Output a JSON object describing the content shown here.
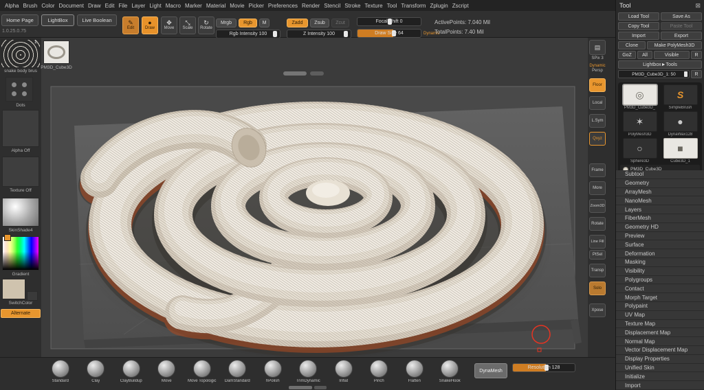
{
  "colors": {
    "accent": "#e8962e",
    "panel": "#2a2a2a",
    "canvas": "#3b3b3b",
    "model": "#e8e1d4",
    "underglow": "#a84a22",
    "cursor_red": "#e63422"
  },
  "icons": {
    "close": "⊠",
    "edit": "✎",
    "draw": "●",
    "move": "✥",
    "scale": "⤡",
    "rotate": "↻",
    "spix": "▤"
  },
  "menubar": {
    "items": [
      "Alpha",
      "Brush",
      "Color",
      "Document",
      "Draw",
      "Edit",
      "File",
      "Layer",
      "Light",
      "Macro",
      "Marker",
      "Material",
      "Movie",
      "Picker",
      "Preferences",
      "Render",
      "Stencil",
      "Stroke",
      "Texture",
      "Tool",
      "Transform",
      "Zplugin",
      "Zscript"
    ]
  },
  "topbar": {
    "version": "1.0.25.0.75",
    "home_page": "Home Page",
    "lightbox": "LightBox",
    "live_boolean": "Live Boolean",
    "edit": "Edit",
    "draw": "Draw",
    "move": "Move",
    "scale": "Scale",
    "rotate": "Rotate",
    "mrgb": "Mrgb",
    "rgb": "Rgb",
    "m": "M",
    "zadd": "Zadd",
    "zsub": "Zsub",
    "zcut": "Zcut",
    "rgb_intensity": {
      "label": "Rgb Intensity",
      "value": "100"
    },
    "z_intensity": {
      "label": "Z Intensity",
      "value": "100"
    },
    "focal_shift": {
      "label": "Focal Shift",
      "value": "0"
    },
    "draw_size": {
      "label": "Draw Size",
      "value": "64"
    },
    "dynamic": "Dynamic",
    "active_points": "ActivePoints: 7.040 Mil",
    "total_points": "TotalPoints: 7.40 Mil"
  },
  "left_shelf": {
    "brush_name": "snake body brus",
    "brush_badge": "1",
    "tool_name": "PM3D_Cube3D",
    "stroke_name": "Dots",
    "alpha": "Alpha Off",
    "texture": "Texture Off",
    "material": "SkinShade4",
    "gradient": "Gradient",
    "switch_color": "SwitchColor",
    "alternate": "Alternate"
  },
  "right_shelf": {
    "spix": "SPix 3",
    "persp_line1": "Dynamic",
    "persp_line2": "Persp",
    "floor": "Floor",
    "local": "Local",
    "lsym": "L.Sym",
    "qxyz": "Qxyz",
    "frame": "Frame",
    "more": "More",
    "zoom": "Zoom3D",
    "rotate": "Rotate",
    "linefill": "Line Fill",
    "ptsel": "PtSel",
    "transp": "Transp",
    "solo": "Solo",
    "xpose": "Xpose"
  },
  "tool_panel": {
    "title": "Tool",
    "load_tool": "Load Tool",
    "save_as": "Save As",
    "copy_tool": "Copy Tool",
    "paste_tool": "Paste Tool",
    "import_btn": "Import",
    "export_btn": "Export",
    "clone": "Clone",
    "make_polymesh": "Make PolyMesh3D",
    "goz": "GoZ",
    "all": "All",
    "visible": "Visible",
    "r1": "R",
    "lightbox_tools": "Lightbox►Tools",
    "active_tool_slider": "PM3D_Cube3D_1: 50",
    "r2": "R",
    "thumbnails": [
      {
        "label": "PM3D_Cube3D_",
        "glyph": "◎",
        "variant": "white selected"
      },
      {
        "label": "SimpleBrush",
        "glyph": "S",
        "variant": "dark",
        "accent": "orange"
      },
      {
        "label": "PolyMesh3D",
        "glyph": "✶",
        "variant": "dark"
      },
      {
        "label": "DynaWax128",
        "glyph": "●",
        "variant": "dark"
      },
      {
        "label": "Sphere3D",
        "glyph": "○",
        "variant": "dark"
      },
      {
        "label": "Cube3D_1",
        "glyph": "■",
        "variant": "white"
      }
    ],
    "active_thumb_label": "PM3D_Cube3D_",
    "sections": [
      "Subtool",
      "Geometry",
      "ArrayMesh",
      "NanoMesh",
      "Layers",
      "FiberMesh",
      "Geometry HD",
      "Preview",
      "Surface",
      "Deformation",
      "Masking",
      "Visibility",
      "Polygroups",
      "Contact",
      "Morph Target",
      "Polypaint",
      "UV Map",
      "Texture Map",
      "Displacement Map",
      "Normal Map",
      "Vector Displacement Map",
      "Display Properties",
      "Unified Skin",
      "Initialize",
      "Import"
    ]
  },
  "bottom_tray": {
    "brushes": [
      "Standard",
      "Clay",
      "ClayBuildup",
      "Move",
      "Move Topologic",
      "DamStandard",
      "hPolish",
      "TrimDynamic",
      "Inflat",
      "Pinch",
      "Flatten",
      "SnakeHook"
    ],
    "dynamesh": "DynaMesh",
    "resolution": {
      "label": "Resolution",
      "value": "128"
    }
  }
}
